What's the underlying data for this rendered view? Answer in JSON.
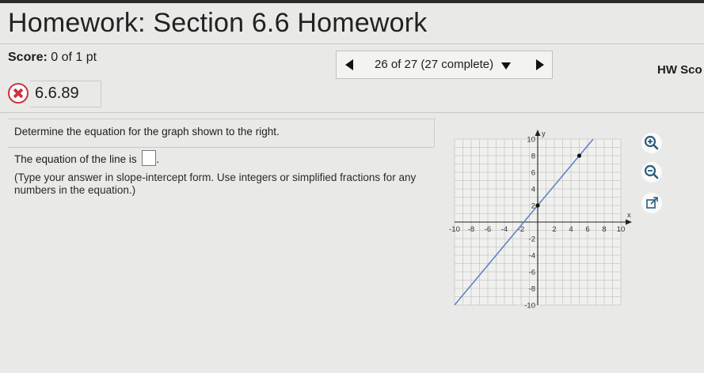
{
  "header": {
    "title": "Homework: Section 6.6 Homework",
    "score_label": "Score:",
    "score_value": "0 of 1 pt",
    "nav_selector": "26 of 27 (27 complete)",
    "hw_score_label": "HW Sco"
  },
  "question": {
    "number": "6.6.89",
    "status": "incorrect",
    "prompt": "Determine the equation for the graph shown to the right.",
    "answer_lead": "The equation of the line is",
    "answer_value": "",
    "instructions": "(Type your answer in slope-intercept form. Use integers or simplified fractions for any numbers in the equation.)"
  },
  "graph": {
    "x_axis_label": "x",
    "y_axis_label": "y",
    "x_range": [
      -10,
      10
    ],
    "y_range": [
      -10,
      10
    ],
    "x_ticks": [
      "-10",
      "-8",
      "-6",
      "-4",
      "-2",
      "2",
      "4",
      "6",
      "8",
      "10"
    ],
    "y_ticks": [
      "10",
      "8",
      "6",
      "4",
      "2",
      "-2",
      "-4",
      "-6",
      "-8",
      "-10"
    ],
    "line_points": [
      [
        0,
        2
      ],
      [
        5,
        8
      ]
    ],
    "line_color": "#5b7fc4"
  },
  "tools": {
    "zoom_in": "zoom-in-icon",
    "zoom_out": "zoom-out-icon",
    "popout": "popout-icon"
  }
}
